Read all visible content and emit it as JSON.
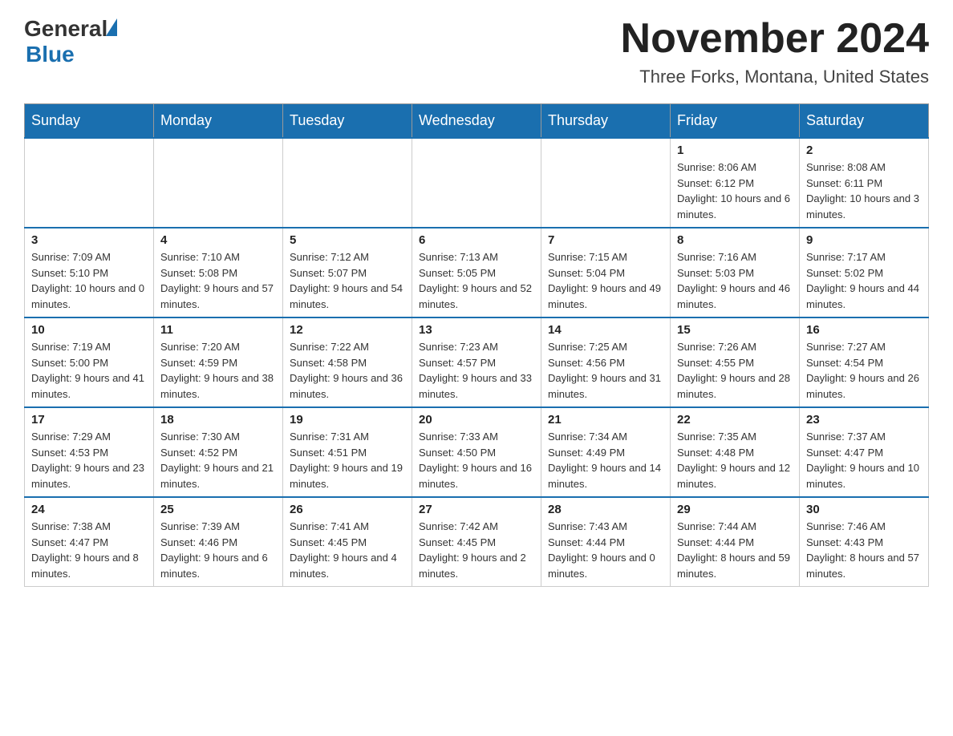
{
  "header": {
    "logo_general": "General",
    "logo_blue": "Blue",
    "title": "November 2024",
    "subtitle": "Three Forks, Montana, United States"
  },
  "weekdays": [
    "Sunday",
    "Monday",
    "Tuesday",
    "Wednesday",
    "Thursday",
    "Friday",
    "Saturday"
  ],
  "weeks": [
    [
      {
        "day": "",
        "info": ""
      },
      {
        "day": "",
        "info": ""
      },
      {
        "day": "",
        "info": ""
      },
      {
        "day": "",
        "info": ""
      },
      {
        "day": "",
        "info": ""
      },
      {
        "day": "1",
        "info": "Sunrise: 8:06 AM\nSunset: 6:12 PM\nDaylight: 10 hours and 6 minutes."
      },
      {
        "day": "2",
        "info": "Sunrise: 8:08 AM\nSunset: 6:11 PM\nDaylight: 10 hours and 3 minutes."
      }
    ],
    [
      {
        "day": "3",
        "info": "Sunrise: 7:09 AM\nSunset: 5:10 PM\nDaylight: 10 hours and 0 minutes."
      },
      {
        "day": "4",
        "info": "Sunrise: 7:10 AM\nSunset: 5:08 PM\nDaylight: 9 hours and 57 minutes."
      },
      {
        "day": "5",
        "info": "Sunrise: 7:12 AM\nSunset: 5:07 PM\nDaylight: 9 hours and 54 minutes."
      },
      {
        "day": "6",
        "info": "Sunrise: 7:13 AM\nSunset: 5:05 PM\nDaylight: 9 hours and 52 minutes."
      },
      {
        "day": "7",
        "info": "Sunrise: 7:15 AM\nSunset: 5:04 PM\nDaylight: 9 hours and 49 minutes."
      },
      {
        "day": "8",
        "info": "Sunrise: 7:16 AM\nSunset: 5:03 PM\nDaylight: 9 hours and 46 minutes."
      },
      {
        "day": "9",
        "info": "Sunrise: 7:17 AM\nSunset: 5:02 PM\nDaylight: 9 hours and 44 minutes."
      }
    ],
    [
      {
        "day": "10",
        "info": "Sunrise: 7:19 AM\nSunset: 5:00 PM\nDaylight: 9 hours and 41 minutes."
      },
      {
        "day": "11",
        "info": "Sunrise: 7:20 AM\nSunset: 4:59 PM\nDaylight: 9 hours and 38 minutes."
      },
      {
        "day": "12",
        "info": "Sunrise: 7:22 AM\nSunset: 4:58 PM\nDaylight: 9 hours and 36 minutes."
      },
      {
        "day": "13",
        "info": "Sunrise: 7:23 AM\nSunset: 4:57 PM\nDaylight: 9 hours and 33 minutes."
      },
      {
        "day": "14",
        "info": "Sunrise: 7:25 AM\nSunset: 4:56 PM\nDaylight: 9 hours and 31 minutes."
      },
      {
        "day": "15",
        "info": "Sunrise: 7:26 AM\nSunset: 4:55 PM\nDaylight: 9 hours and 28 minutes."
      },
      {
        "day": "16",
        "info": "Sunrise: 7:27 AM\nSunset: 4:54 PM\nDaylight: 9 hours and 26 minutes."
      }
    ],
    [
      {
        "day": "17",
        "info": "Sunrise: 7:29 AM\nSunset: 4:53 PM\nDaylight: 9 hours and 23 minutes."
      },
      {
        "day": "18",
        "info": "Sunrise: 7:30 AM\nSunset: 4:52 PM\nDaylight: 9 hours and 21 minutes."
      },
      {
        "day": "19",
        "info": "Sunrise: 7:31 AM\nSunset: 4:51 PM\nDaylight: 9 hours and 19 minutes."
      },
      {
        "day": "20",
        "info": "Sunrise: 7:33 AM\nSunset: 4:50 PM\nDaylight: 9 hours and 16 minutes."
      },
      {
        "day": "21",
        "info": "Sunrise: 7:34 AM\nSunset: 4:49 PM\nDaylight: 9 hours and 14 minutes."
      },
      {
        "day": "22",
        "info": "Sunrise: 7:35 AM\nSunset: 4:48 PM\nDaylight: 9 hours and 12 minutes."
      },
      {
        "day": "23",
        "info": "Sunrise: 7:37 AM\nSunset: 4:47 PM\nDaylight: 9 hours and 10 minutes."
      }
    ],
    [
      {
        "day": "24",
        "info": "Sunrise: 7:38 AM\nSunset: 4:47 PM\nDaylight: 9 hours and 8 minutes."
      },
      {
        "day": "25",
        "info": "Sunrise: 7:39 AM\nSunset: 4:46 PM\nDaylight: 9 hours and 6 minutes."
      },
      {
        "day": "26",
        "info": "Sunrise: 7:41 AM\nSunset: 4:45 PM\nDaylight: 9 hours and 4 minutes."
      },
      {
        "day": "27",
        "info": "Sunrise: 7:42 AM\nSunset: 4:45 PM\nDaylight: 9 hours and 2 minutes."
      },
      {
        "day": "28",
        "info": "Sunrise: 7:43 AM\nSunset: 4:44 PM\nDaylight: 9 hours and 0 minutes."
      },
      {
        "day": "29",
        "info": "Sunrise: 7:44 AM\nSunset: 4:44 PM\nDaylight: 8 hours and 59 minutes."
      },
      {
        "day": "30",
        "info": "Sunrise: 7:46 AM\nSunset: 4:43 PM\nDaylight: 8 hours and 57 minutes."
      }
    ]
  ]
}
